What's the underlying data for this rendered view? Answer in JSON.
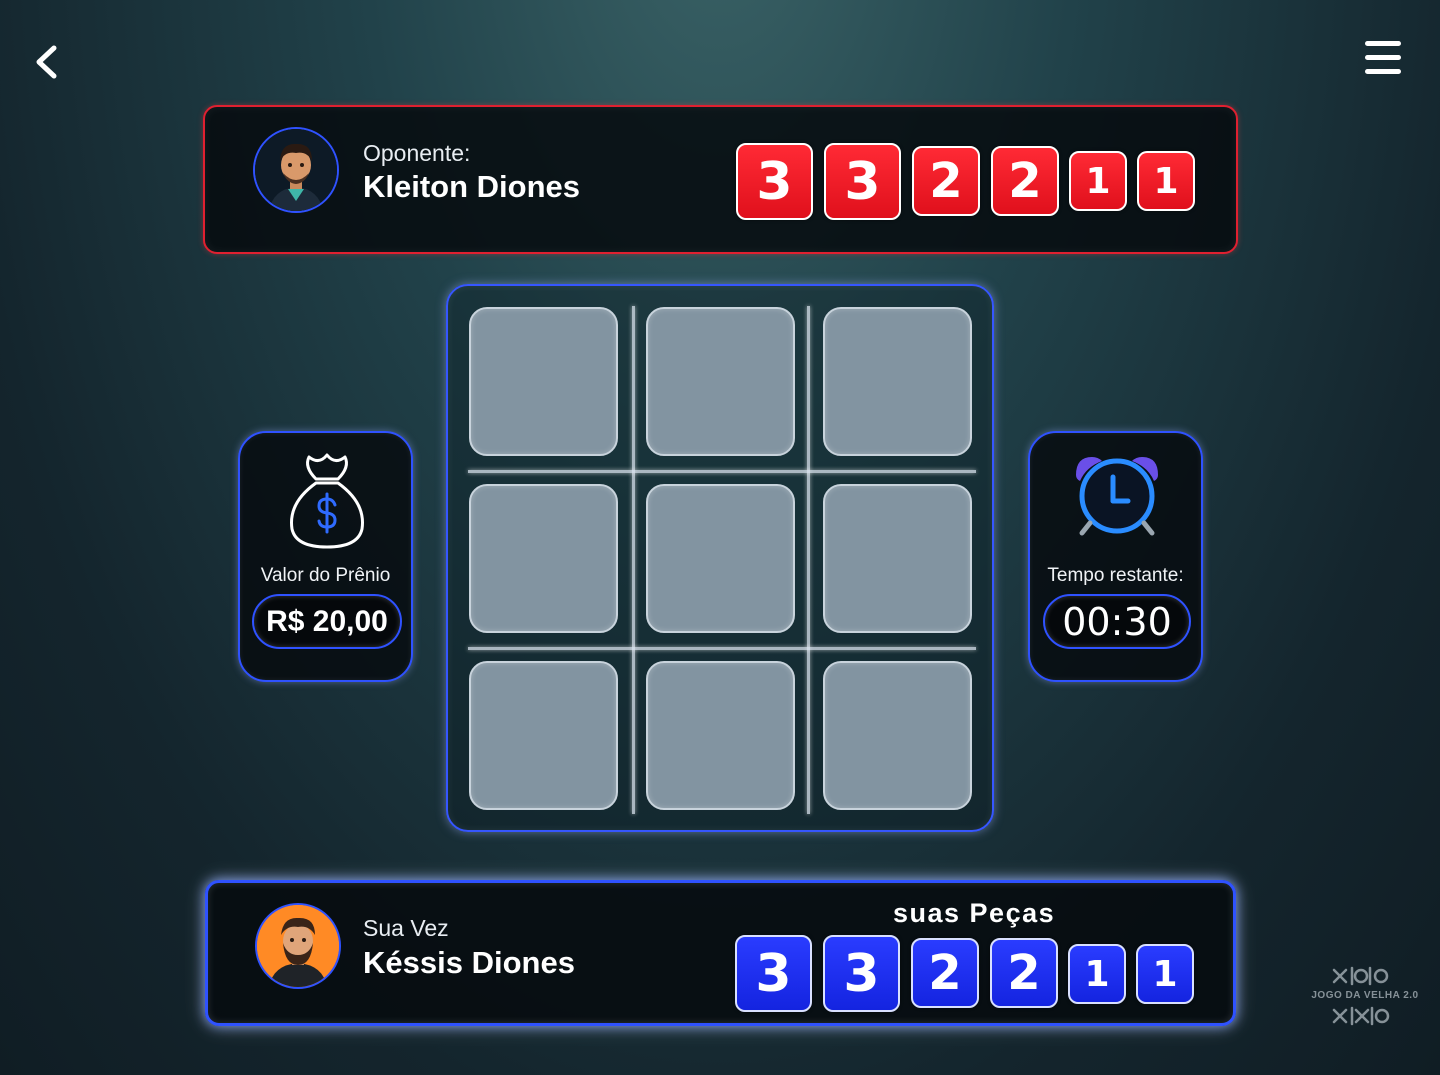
{
  "nav": {
    "back_icon": "chevron-left-icon",
    "menu_icon": "hamburger-menu-icon"
  },
  "opponent": {
    "label": "Oponente:",
    "name": "Kleiton Diones",
    "pieces": [
      "3",
      "3",
      "2",
      "2",
      "1",
      "1"
    ],
    "color": "#e0101c"
  },
  "player": {
    "label": "Sua Vez",
    "name": "Késsis Diones",
    "pieces_title": "suas Peças",
    "pieces": [
      "3",
      "3",
      "2",
      "2",
      "1",
      "1"
    ],
    "color": "#1424e0"
  },
  "board": {
    "cells": [
      "",
      "",
      "",
      "",
      "",
      "",
      "",
      "",
      ""
    ]
  },
  "prize": {
    "icon": "money-bag-icon",
    "label": "Valor do Prênio",
    "value": "R$ 20,00"
  },
  "timer": {
    "icon": "alarm-clock-icon",
    "label": "Tempo restante:",
    "value": "00:30"
  },
  "logo": {
    "text": "JOGO DA VELHA 2.0"
  },
  "colors": {
    "accent": "#2f52ff",
    "opponent_border": "#e02030"
  }
}
